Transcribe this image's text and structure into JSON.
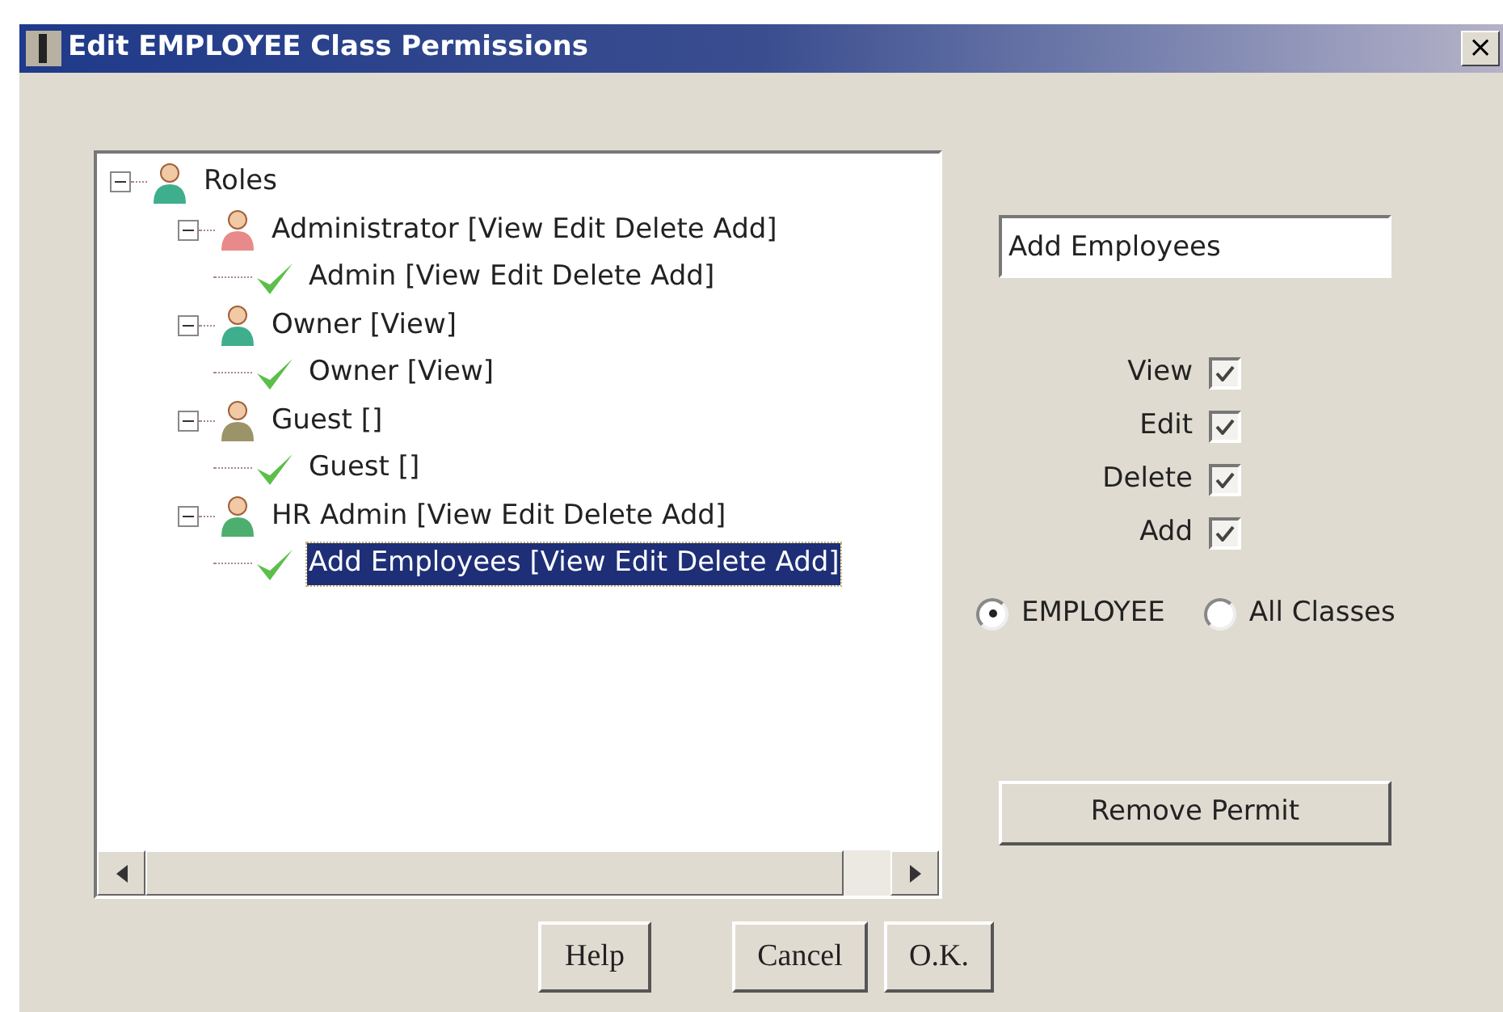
{
  "window": {
    "title": "Edit EMPLOYEE Class Permissions",
    "close": "×"
  },
  "tree": {
    "label": "Roles",
    "expanded": true,
    "selected": false,
    "color": "#3fae8c",
    "children": [
      {
        "label": "Administrator [View Edit Delete Add]",
        "expanded": true,
        "selected": false,
        "color": "#e88a8a",
        "children": [
          {
            "label": "Admin [View Edit Delete Add]",
            "selected": false
          }
        ]
      },
      {
        "label": "Owner [View]",
        "expanded": true,
        "selected": false,
        "color": "#3fae8c",
        "children": [
          {
            "label": "Owner [View]",
            "selected": false
          }
        ]
      },
      {
        "label": "Guest []",
        "expanded": true,
        "selected": false,
        "color": "#9a9468",
        "children": [
          {
            "label": "Guest []",
            "selected": false
          }
        ]
      },
      {
        "label": "HR Admin [View Edit Delete Add]",
        "expanded": true,
        "selected": false,
        "color": "#4caf6e",
        "children": [
          {
            "label": "Add Employees [View Edit Delete Add]",
            "selected": true
          }
        ]
      }
    ]
  },
  "name_field": {
    "value": "Add Employees"
  },
  "permissions": [
    {
      "label": "View",
      "checked": true
    },
    {
      "label": "Edit",
      "checked": true
    },
    {
      "label": "Delete",
      "checked": true
    },
    {
      "label": "Add",
      "checked": true
    }
  ],
  "scope": [
    {
      "label": "EMPLOYEE",
      "selected": true
    },
    {
      "label": "All Classes",
      "selected": false
    }
  ],
  "remove_button": "Remove Permit",
  "buttons": [
    "Help",
    "Cancel",
    "O.K."
  ]
}
